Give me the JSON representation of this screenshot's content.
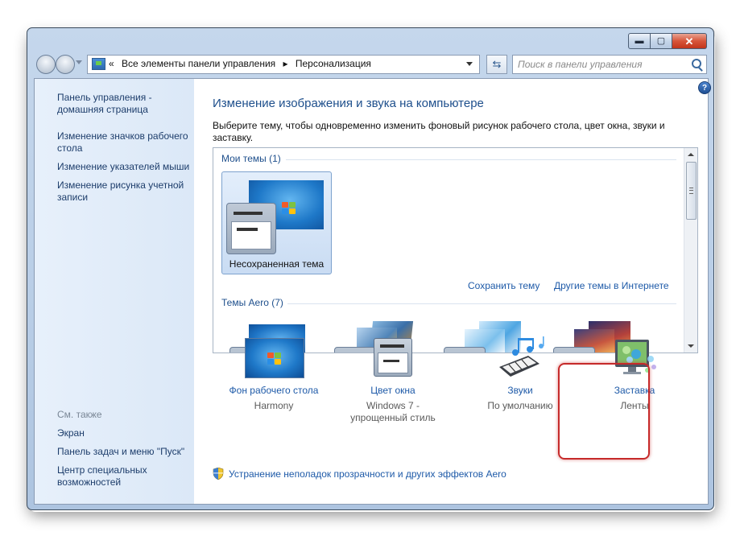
{
  "colors": {
    "accent": "#1e5aa8",
    "title": "#1e4f8c",
    "highlight": "#c62a2a"
  },
  "window": {
    "caption_buttons": {
      "minimize": "minimize-icon",
      "maximize": "maximize-icon",
      "close": "close-icon"
    }
  },
  "address_bar": {
    "crumbs": [
      "«",
      "Все элементы панели управления",
      "▸",
      "Персонализация"
    ]
  },
  "search": {
    "placeholder": "Поиск в панели управления",
    "icon": "search-icon"
  },
  "sidebar": {
    "links": [
      "Панель управления - домашняя страница",
      "Изменение значков рабочего стола",
      "Изменение указателей мыши",
      "Изменение рисунка учетной записи"
    ],
    "see_also_label": "См. также",
    "see_also": [
      "Экран",
      "Панель задач и меню \"Пуск\"",
      "Центр специальных возможностей"
    ]
  },
  "main": {
    "title": "Изменение изображения и звука на компьютере",
    "description": "Выберите тему, чтобы одновременно изменить фоновый рисунок рабочего стола, цвет окна, звуки и заставку.",
    "my_themes_header": "Мои темы (1)",
    "unsaved_theme": "Несохраненная тема",
    "save_theme": "Сохранить тему",
    "more_themes": "Другие темы в Интернете",
    "aero_header": "Темы Aero (7)",
    "troubleshoot": "Устранение неполадок прозрачности и других эффектов Aero"
  },
  "bottom": [
    {
      "label": "Фон рабочего стола",
      "value": "Harmony",
      "icon": "desktop-background-icon"
    },
    {
      "label": "Цвет окна",
      "value": "Windows 7 - упрощенный стиль",
      "icon": "window-color-icon"
    },
    {
      "label": "Звуки",
      "value": "По умолчанию",
      "icon": "sounds-icon"
    },
    {
      "label": "Заставка",
      "value": "Ленты",
      "icon": "screensaver-icon"
    }
  ]
}
